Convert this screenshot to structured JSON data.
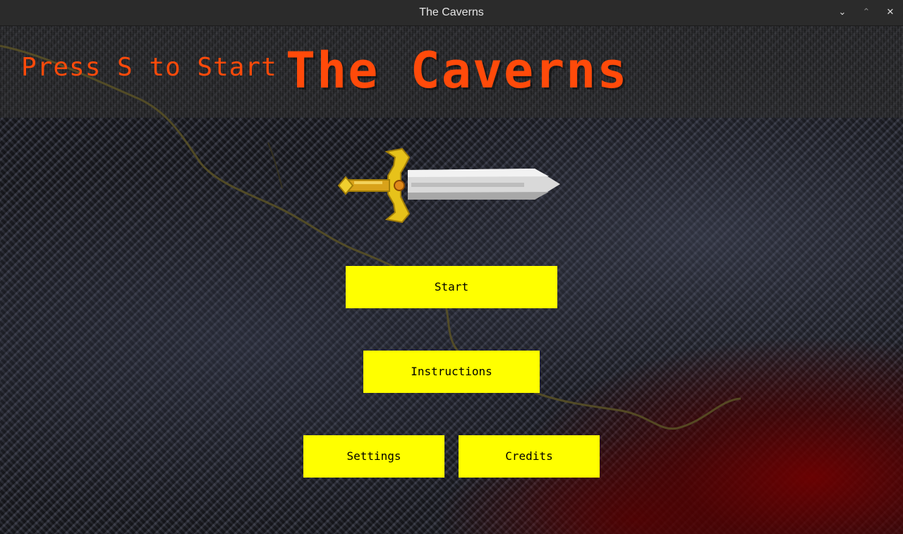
{
  "window": {
    "title": "The Caverns",
    "controls": {
      "minimize_icon": "chevron-down-icon",
      "maximize_icon": "chevron-up-icon",
      "close_icon": "close-icon"
    }
  },
  "game": {
    "hint": "Press S to Start",
    "title": "The Caverns",
    "emblem_icon": "sword-icon",
    "buttons": {
      "start": "Start",
      "instructions": "Instructions",
      "settings": "Settings",
      "credits": "Credits"
    },
    "colors": {
      "accent": "#ff4a0a",
      "button": "#ffff00",
      "button_text": "#000000"
    }
  }
}
